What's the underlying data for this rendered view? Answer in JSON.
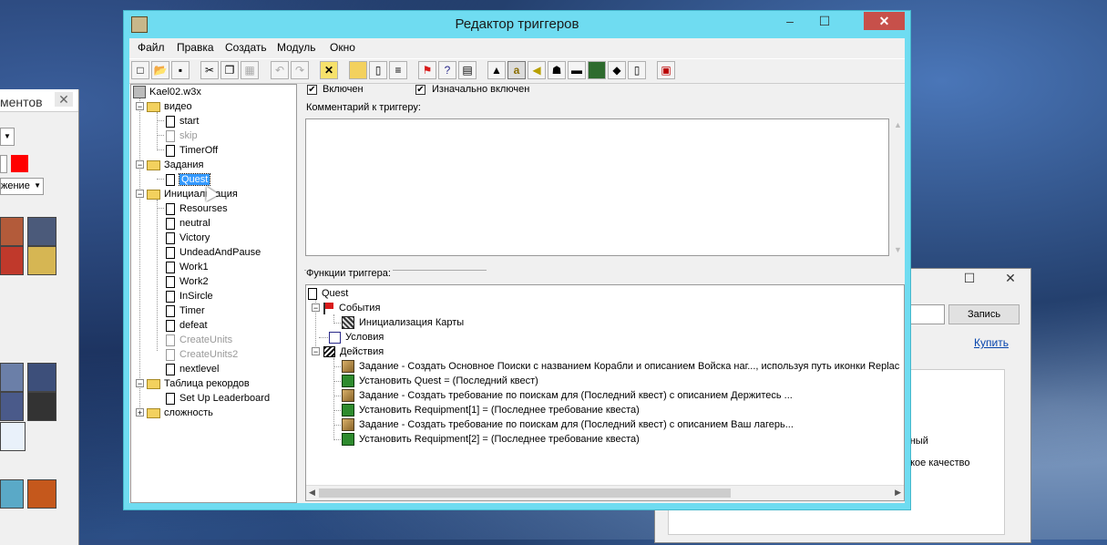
{
  "left_window": {
    "caption": "ментов",
    "dropdown_value": "жение"
  },
  "right_window": {
    "record_button": "Запись",
    "buy_link": "Купить",
    "text1": "чный",
    "text2": "окое качество"
  },
  "window": {
    "title": "Редактор триггеров",
    "minimize": "–",
    "maximize": "☐",
    "close": "✕"
  },
  "menu": [
    "Файл",
    "Правка",
    "Создать",
    "Модуль",
    "Окно"
  ],
  "toolbar": [
    "new-icon",
    "open-icon",
    "save-icon",
    "cut-icon",
    "copy-icon",
    "paste-icon",
    "undo-icon",
    "redo-icon",
    "delete-icon",
    "new-category-icon",
    "new-trigger-icon",
    "new-comment-icon",
    "new-event-icon",
    "new-condition-icon",
    "new-action-icon",
    "terrain-editor-icon",
    "trigger-editor-icon",
    "sound-editor-icon",
    "object-editor-icon",
    "campaign-editor-icon",
    "ai-editor-icon",
    "object-manager-icon",
    "import-manager-icon",
    "test-map-icon"
  ],
  "tree": {
    "map": "Kael02.w3x",
    "categories": [
      {
        "name": "видео",
        "expanded": true,
        "items": [
          {
            "name": "start",
            "enabled": true
          },
          {
            "name": "skip",
            "enabled": false
          },
          {
            "name": "TimerOff",
            "enabled": true
          }
        ]
      },
      {
        "name": "Задания",
        "expanded": true,
        "items": [
          {
            "name": "Quest",
            "enabled": true,
            "selected": true
          }
        ]
      },
      {
        "name": "Инициализация",
        "expanded": true,
        "items": [
          {
            "name": "Resourses",
            "enabled": true
          },
          {
            "name": "neutral",
            "enabled": true
          },
          {
            "name": "Victory",
            "enabled": true
          },
          {
            "name": "UndeadAndPause",
            "enabled": true
          },
          {
            "name": "Work1",
            "enabled": true
          },
          {
            "name": "Work2",
            "enabled": true
          },
          {
            "name": "InSircle",
            "enabled": true
          },
          {
            "name": "Timer",
            "enabled": true
          },
          {
            "name": "defeat",
            "enabled": true
          },
          {
            "name": "CreateUnits",
            "enabled": false
          },
          {
            "name": "CreateUnits2",
            "enabled": false
          },
          {
            "name": "nextlevel",
            "enabled": true
          }
        ]
      },
      {
        "name": "Таблица рекордов",
        "expanded": true,
        "items": [
          {
            "name": "Set Up Leaderboard",
            "enabled": true
          }
        ]
      },
      {
        "name": "сложность",
        "expanded": false,
        "items": []
      }
    ]
  },
  "trigger": {
    "enabled_label": "Включен",
    "enabled": true,
    "initially_on_label": "Изначально включен",
    "initially_on": true,
    "comment_label": "Комментарий к триггеру:",
    "comment": "",
    "functions_label": "Функции триггера:",
    "name": "Quest",
    "events_label": "События",
    "events": [
      "Инициализация Карты"
    ],
    "conditions_label": "Условия",
    "actions_label": "Действия",
    "actions": [
      {
        "type": "quest",
        "text": "Задание - Создать Основное Поиски с названием Корабли и описанием Войска наг..., используя путь иконки Replac"
      },
      {
        "type": "set",
        "text": "Установить Quest = (Последний квест)"
      },
      {
        "type": "quest",
        "text": "Задание - Создать требование по поискам для (Последний квест) с описанием Держитесь ..."
      },
      {
        "type": "set",
        "text": "Установить Requipment[1] = (Последнее требование квеста)"
      },
      {
        "type": "quest",
        "text": "Задание - Создать требование по поискам для (Последний квест) с описанием Ваш лагерь..."
      },
      {
        "type": "set",
        "text": "Установить Requipment[2] = (Последнее требование квеста)"
      }
    ]
  }
}
